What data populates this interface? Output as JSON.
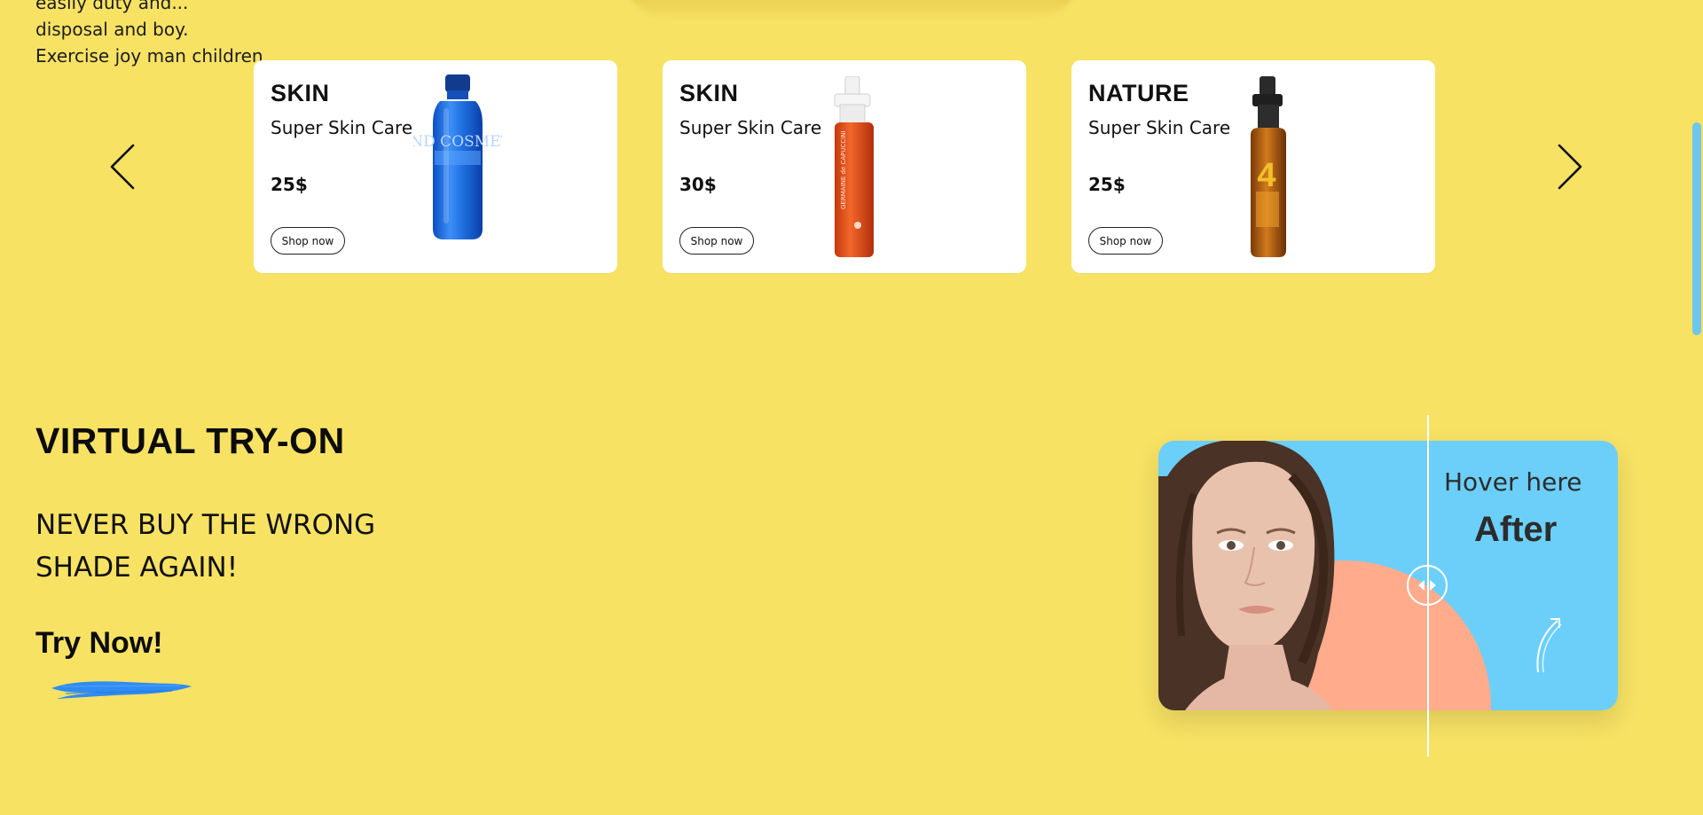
{
  "top_text": {
    "line_partial": "easily duty and...",
    "line1": "disposal and boy.",
    "line2": "Exercise joy man children"
  },
  "carousel": {
    "prev_icon": "chevron-left-icon",
    "next_icon": "chevron-right-icon",
    "cards": [
      {
        "category": "SKIN",
        "name": "Super Skin Care",
        "price": "25$",
        "button": "Shop now",
        "product_icon": "blue-bottle",
        "product_label": "BRAND COSMETICS",
        "product_color": "#1f6fe0"
      },
      {
        "category": "SKIN",
        "name": "Super Skin Care",
        "price": "30$",
        "button": "Shop now",
        "product_icon": "orange-spray-bottle",
        "product_label": "GERMAINE de CAPUCCINI",
        "product_color": "#e6521c"
      },
      {
        "category": "NATURE",
        "name": "Super Skin Care",
        "price": "25$",
        "button": "Shop now",
        "product_icon": "amber-spray-bottle",
        "product_label": "4",
        "product_color": "#c8741a"
      }
    ]
  },
  "virtual_tryon": {
    "title": "VIRTUAL TRY-ON",
    "subtitle": "NEVER BUY THE WRONG SHADE AGAIN!",
    "cta": "Try Now!",
    "brush_color": "#2f8cf3",
    "widget": {
      "hover_text": "Hover here",
      "after_text": "After",
      "bg_color": "#6ccff9",
      "arc_color": "#ffab8c"
    }
  },
  "colors": {
    "page_bg": "#f7e264",
    "card_bg": "#ffffff",
    "scroll_thumb": "#6cc7ee"
  }
}
